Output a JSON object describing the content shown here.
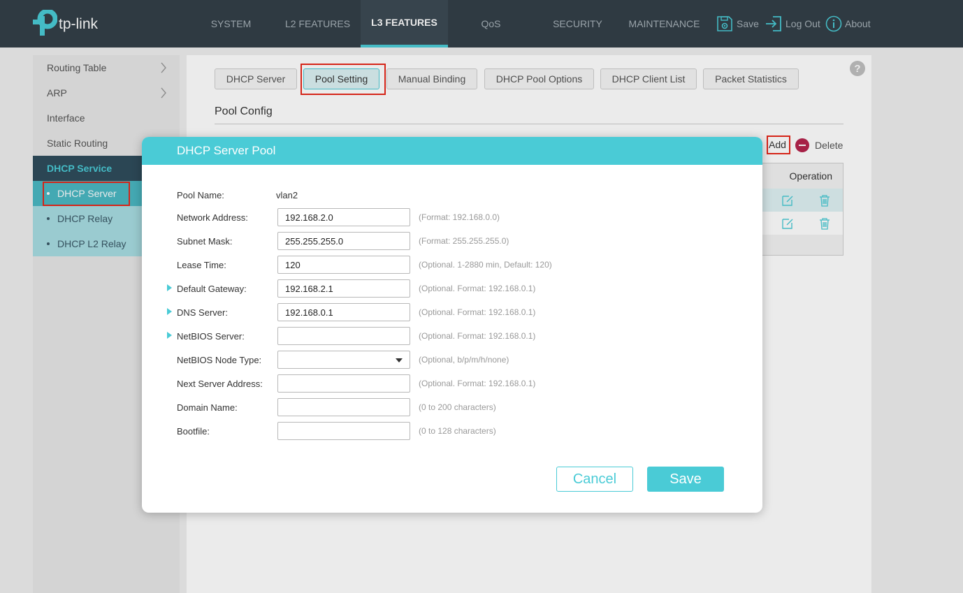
{
  "brand": {
    "name": "tp-link",
    "accent": "#4acbd6",
    "topbar_bg": "#333f48"
  },
  "nav": {
    "items": [
      {
        "label": "SYSTEM",
        "active": false
      },
      {
        "label": "L2 FEATURES",
        "active": false
      },
      {
        "label": "L3 FEATURES",
        "active": true
      },
      {
        "label": "QoS",
        "active": false
      },
      {
        "label": "SECURITY",
        "active": false
      },
      {
        "label": "MAINTENANCE",
        "active": false
      }
    ],
    "actions": {
      "save": "Save",
      "logout": "Log Out",
      "about": "About"
    }
  },
  "sidebar": {
    "items": [
      {
        "label": "Routing Table",
        "icon": "chevron-right-icon"
      },
      {
        "label": "ARP",
        "icon": "chevron-right-icon"
      },
      {
        "label": "Interface"
      },
      {
        "label": "Static Routing"
      }
    ],
    "section": "DHCP Service",
    "subitems": [
      {
        "label": "DHCP Server",
        "selected": true
      },
      {
        "label": "DHCP Relay",
        "selected": false
      },
      {
        "label": "DHCP L2 Relay",
        "selected": false
      }
    ]
  },
  "tabs": [
    {
      "label": "DHCP Server"
    },
    {
      "label": "Pool Setting",
      "active": true
    },
    {
      "label": "Manual Binding"
    },
    {
      "label": "DHCP Pool Options"
    },
    {
      "label": "DHCP Client List"
    },
    {
      "label": "Packet Statistics"
    }
  ],
  "help_icon": "?",
  "pool_config": {
    "title": "Pool Config",
    "add_label": "Add",
    "delete_label": "Delete",
    "operation_header": "Operation"
  },
  "modal": {
    "title": "DHCP Server Pool",
    "fields": {
      "pool_name": {
        "label": "Pool Name:",
        "value": "vlan2"
      },
      "network_address": {
        "label": "Network Address:",
        "value": "192.168.2.0",
        "hint": "(Format: 192.168.0.0)"
      },
      "subnet_mask": {
        "label": "Subnet Mask:",
        "value": "255.255.255.0",
        "hint": "(Format: 255.255.255.0)"
      },
      "lease_time": {
        "label": "Lease Time:",
        "value": "120",
        "hint": "(Optional. 1-2880 min, Default: 120)"
      },
      "default_gateway": {
        "label": "Default Gateway:",
        "value": "192.168.2.1",
        "hint": "(Optional. Format: 192.168.0.1)"
      },
      "dns_server": {
        "label": "DNS Server:",
        "value": "192.168.0.1",
        "hint": "(Optional. Format: 192.168.0.1)"
      },
      "netbios_server": {
        "label": "NetBIOS Server:",
        "value": "",
        "hint": "(Optional. Format: 192.168.0.1)"
      },
      "netbios_node_type": {
        "label": "NetBIOS Node Type:",
        "value": "",
        "hint": "(Optional, b/p/m/h/none)"
      },
      "next_server_address": {
        "label": "Next Server Address:",
        "value": "",
        "hint": "(Optional. Format: 192.168.0.1)"
      },
      "domain_name": {
        "label": "Domain Name:",
        "value": "",
        "hint": "(0 to 200 characters)"
      },
      "bootfile": {
        "label": "Bootfile:",
        "value": "",
        "hint": "(0 to 128 characters)"
      }
    },
    "cancel_label": "Cancel",
    "save_label": "Save"
  }
}
